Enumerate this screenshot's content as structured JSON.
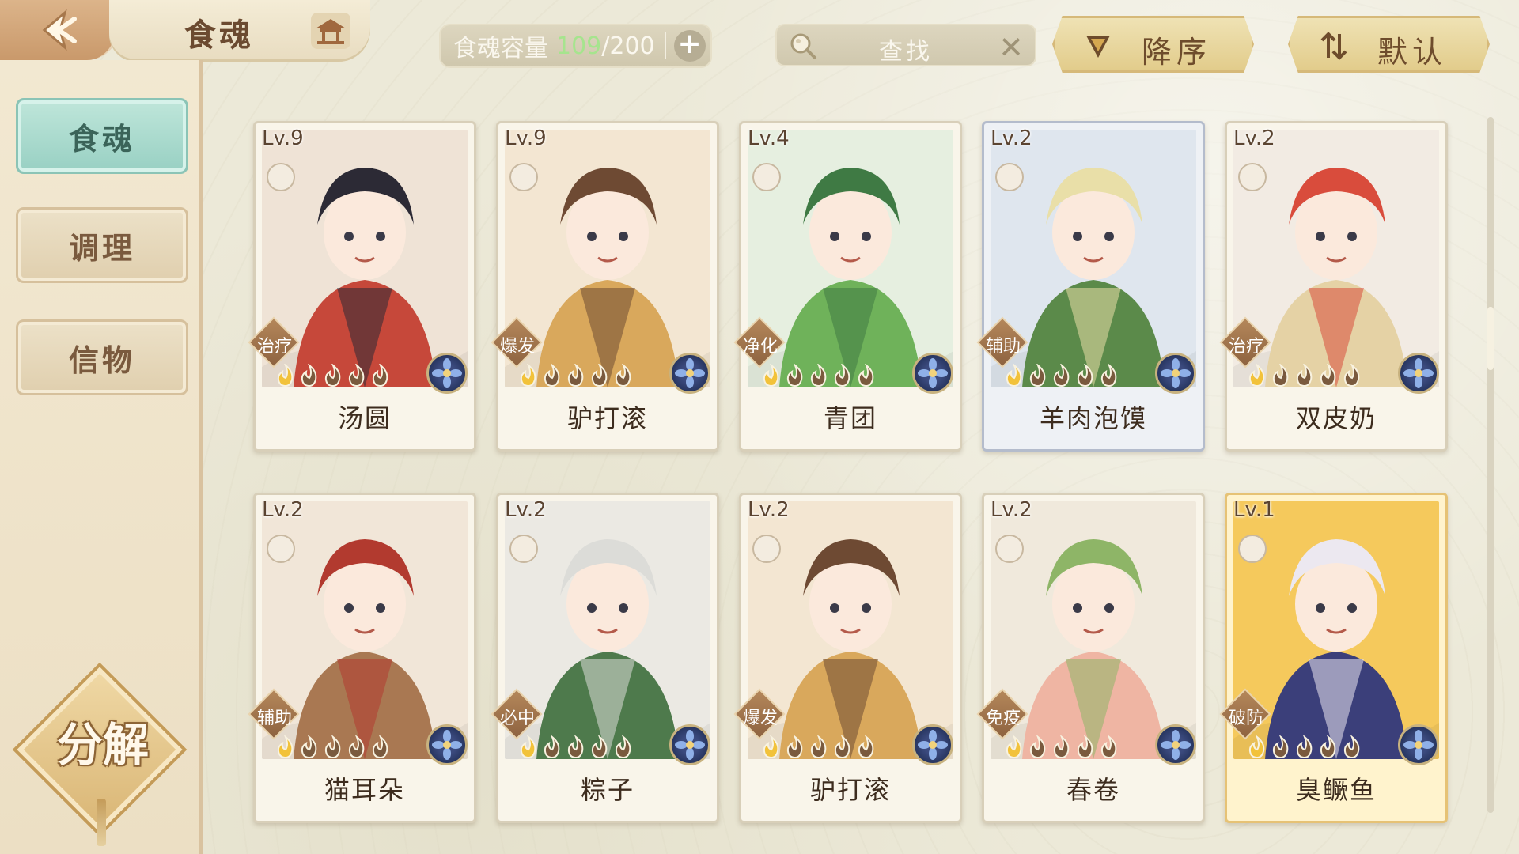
{
  "header": {
    "title": "食魂",
    "capacity_label": "食魂容量",
    "capacity_current": "109",
    "capacity_max": "/200",
    "search_placeholder": "查找",
    "sort_order_label": "降序",
    "sort_mode_label": "默认"
  },
  "sidebar": {
    "tabs": [
      {
        "label": "食魂",
        "active": true
      },
      {
        "label": "调理",
        "active": false
      },
      {
        "label": "信物",
        "active": false
      }
    ],
    "decompose_label": "分解"
  },
  "cards": [
    {
      "level": "Lv.9",
      "name": "汤圆",
      "role": "治疗",
      "stars": 1,
      "palette": [
        "#efe3d6",
        "#c6483a",
        "#2c2a35"
      ]
    },
    {
      "level": "Lv.9",
      "name": "驴打滚",
      "role": "爆发",
      "stars": 1,
      "palette": [
        "#f3e6d2",
        "#d9a85c",
        "#6e4a33"
      ]
    },
    {
      "level": "Lv.4",
      "name": "青团",
      "role": "净化",
      "stars": 1,
      "palette": [
        "#e6efe0",
        "#6fb25a",
        "#3f7a44"
      ]
    },
    {
      "level": "Lv.2",
      "name": "羊肉泡馍",
      "role": "辅助",
      "stars": 1,
      "palette": [
        "#dfe6ee",
        "#5b8a4a",
        "#e9dfa8"
      ]
    },
    {
      "level": "Lv.2",
      "name": "双皮奶",
      "role": "治疗",
      "stars": 1,
      "palette": [
        "#f2ebe3",
        "#e5d2a5",
        "#d94c3c"
      ]
    },
    {
      "level": "Lv.2",
      "name": "猫耳朵",
      "role": "辅助",
      "stars": 1,
      "palette": [
        "#f1e6d8",
        "#a97852",
        "#b23a2f"
      ]
    },
    {
      "level": "Lv.2",
      "name": "粽子",
      "role": "必中",
      "stars": 1,
      "palette": [
        "#ebe9e3",
        "#4e7a4c",
        "#dcdcd8"
      ]
    },
    {
      "level": "Lv.2",
      "name": "驴打滚",
      "role": "爆发",
      "stars": 1,
      "palette": [
        "#f3e6d2",
        "#d9a85c",
        "#6e4a33"
      ]
    },
    {
      "level": "Lv.2",
      "name": "春卷",
      "role": "免疫",
      "stars": 1,
      "palette": [
        "#f0e9dc",
        "#efb5a3",
        "#8eb567"
      ]
    },
    {
      "level": "Lv.1",
      "name": "臭鳜鱼",
      "role": "破防",
      "stars": 1,
      "palette": [
        "#f5c95c",
        "#3b3f7a",
        "#ece8f0"
      ]
    }
  ],
  "colors": {
    "accent_teal": "#98d0c3",
    "gold": "#e2cc8b",
    "capacity_highlight": "#a6e48e"
  },
  "icons": {
    "back": "back-arrow-icon",
    "home": "pavilion-icon",
    "search": "magnifier-icon",
    "clear": "close-icon",
    "sort": "triangle-down-icon",
    "default": "sort-arrows-icon"
  }
}
